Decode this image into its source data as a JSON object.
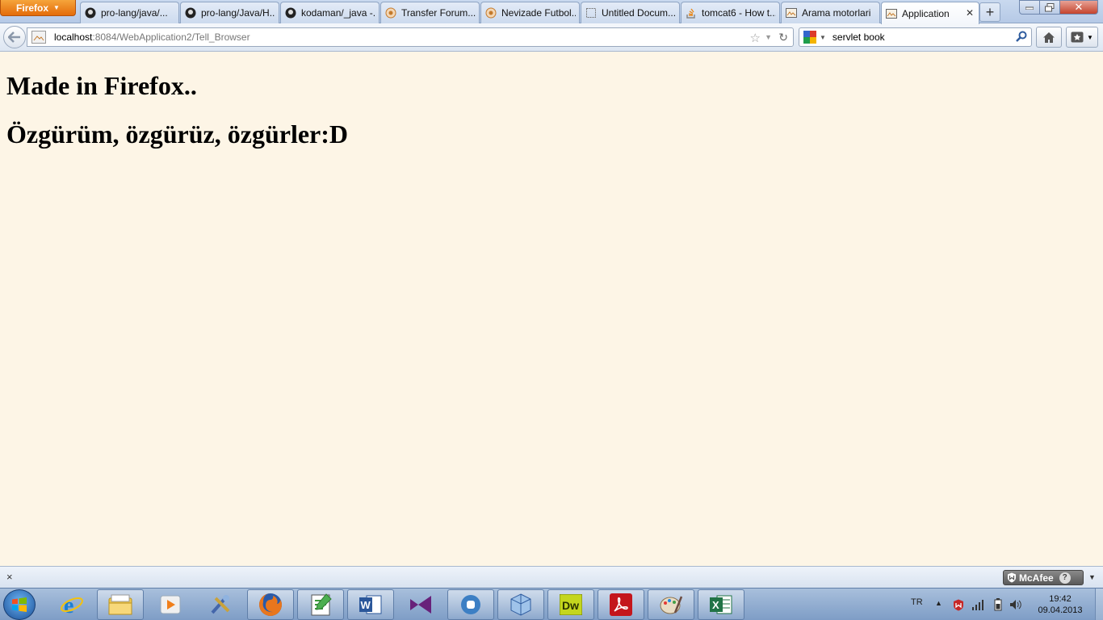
{
  "window": {
    "app_menu_label": "Firefox",
    "close_glyph": "✕"
  },
  "tabs": [
    {
      "title": "pro-lang/java/...",
      "icon": "github-icon"
    },
    {
      "title": "pro-lang/Java/H...",
      "icon": "github-icon"
    },
    {
      "title": "kodaman/_java -...",
      "icon": "github-icon"
    },
    {
      "title": "Transfer Forum...",
      "icon": "forum-icon"
    },
    {
      "title": "Nevizade Futbol...",
      "icon": "forum-icon"
    },
    {
      "title": "Untitled Docum...",
      "icon": "document-icon"
    },
    {
      "title": "tomcat6 - How t...",
      "icon": "stackoverflow-icon"
    },
    {
      "title": "Arama motorlari",
      "icon": "page-icon"
    },
    {
      "title": "Application",
      "icon": "page-icon",
      "active": true,
      "close": "✕"
    }
  ],
  "navigation": {
    "url_host": "localhost",
    "url_rest": ":8084/WebApplication2/Tell_Browser",
    "search_value": "servlet book"
  },
  "page": {
    "heading_1": "Made in Firefox..",
    "heading_2": "Özgürüm, özgürüz, özgürler:D",
    "background": "#fdf5e6"
  },
  "addon_bar": {
    "close_glyph": "×",
    "mcafee_label": "McAfee",
    "mcafee_help": "?"
  },
  "taskbar": {
    "apps": [
      {
        "name": "internet-explorer-icon",
        "running": false
      },
      {
        "name": "file-explorer-icon",
        "running": true
      },
      {
        "name": "media-player-icon",
        "running": false
      },
      {
        "name": "tools-icon",
        "running": false
      },
      {
        "name": "firefox-icon",
        "running": true
      },
      {
        "name": "notepad-icon",
        "running": true
      },
      {
        "name": "word-icon",
        "running": true
      },
      {
        "name": "visual-studio-icon",
        "running": false
      },
      {
        "name": "app-circle-icon",
        "running": true
      },
      {
        "name": "virtualbox-icon",
        "running": true
      },
      {
        "name": "dreamweaver-icon",
        "running": true
      },
      {
        "name": "acrobat-icon",
        "running": true
      },
      {
        "name": "paint-icon",
        "running": true
      },
      {
        "name": "excel-icon",
        "running": true
      }
    ],
    "tray_language": "TR",
    "clock_time": "19:42",
    "clock_date": "09.04.2013"
  }
}
